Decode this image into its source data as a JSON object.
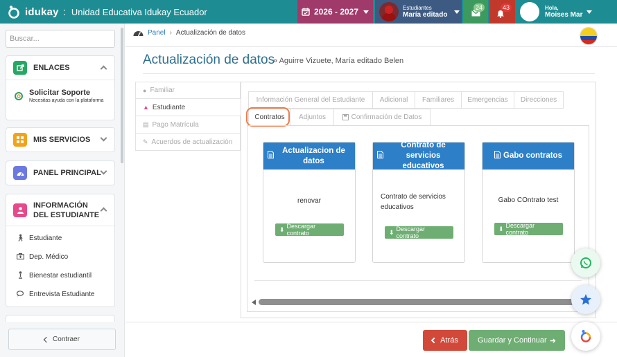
{
  "topbar": {
    "brand": "idukay",
    "separator": ":",
    "school": "Unidad Educativa Idukay Ecuador",
    "year": "2026 - 2027",
    "student_label": "Estudiantes",
    "student_name": "María editado",
    "messages_count": "24",
    "notifications_count": "43",
    "greeting": "Hola,",
    "user_name": "Moises Mar"
  },
  "sidebar": {
    "search_placeholder": "Buscar...",
    "enlaces": {
      "title": "ENLACES",
      "support_title": "Solicitar Soporte",
      "support_sub": "Necesitas ayuda con la plataforma"
    },
    "mis_servicios": "MIS SERVICIOS",
    "panel_principal": "PANEL PRINCIPAL",
    "info_estudiante": {
      "title": "INFORMACIÓN DEL ESTUDIANTE",
      "items": [
        {
          "label": "Estudiante"
        },
        {
          "label": "Dep. Médico"
        },
        {
          "label": "Bienestar estudiantil"
        },
        {
          "label": "Entrevista Estudiante"
        }
      ]
    },
    "collapse": "Contraer"
  },
  "breadcrumb": {
    "panel": "Panel",
    "current": "Actualización de datos"
  },
  "page": {
    "title": "Actualización de datos",
    "subtitle": "» Aguirre Vizuete, María editado Belen"
  },
  "vtabs": [
    "Familiar",
    "Estudiante",
    "Pago Matrícula",
    "Acuerdos de actualización"
  ],
  "htabs_row1": [
    "Información General del Estudiante",
    "Adicional",
    "Familiares",
    "Emergencias",
    "Direcciones"
  ],
  "htabs_row2": [
    "Contratos",
    "Adjuntos",
    "Confirmación de Datos"
  ],
  "contracts": [
    {
      "title": "Actualizacion de datos",
      "description": "renovar",
      "button": "Descargar contrato"
    },
    {
      "title": "Contrato de servicios educativos",
      "description": "Contrato de servicios educativos",
      "button": "Descargar contrato"
    },
    {
      "title": "Gabo contratos",
      "description": "Gabo COntrato test",
      "button": "Descargar contrato"
    }
  ],
  "actions": {
    "back": "Atrás",
    "next": "Guardar y Continuar"
  },
  "colors": {
    "topbar": "#1e8d93",
    "year": "#a03a6a",
    "card_header": "#2d7fc8",
    "success": "#6fae73",
    "danger": "#d2493a",
    "highlight": "#ee7b4b"
  }
}
